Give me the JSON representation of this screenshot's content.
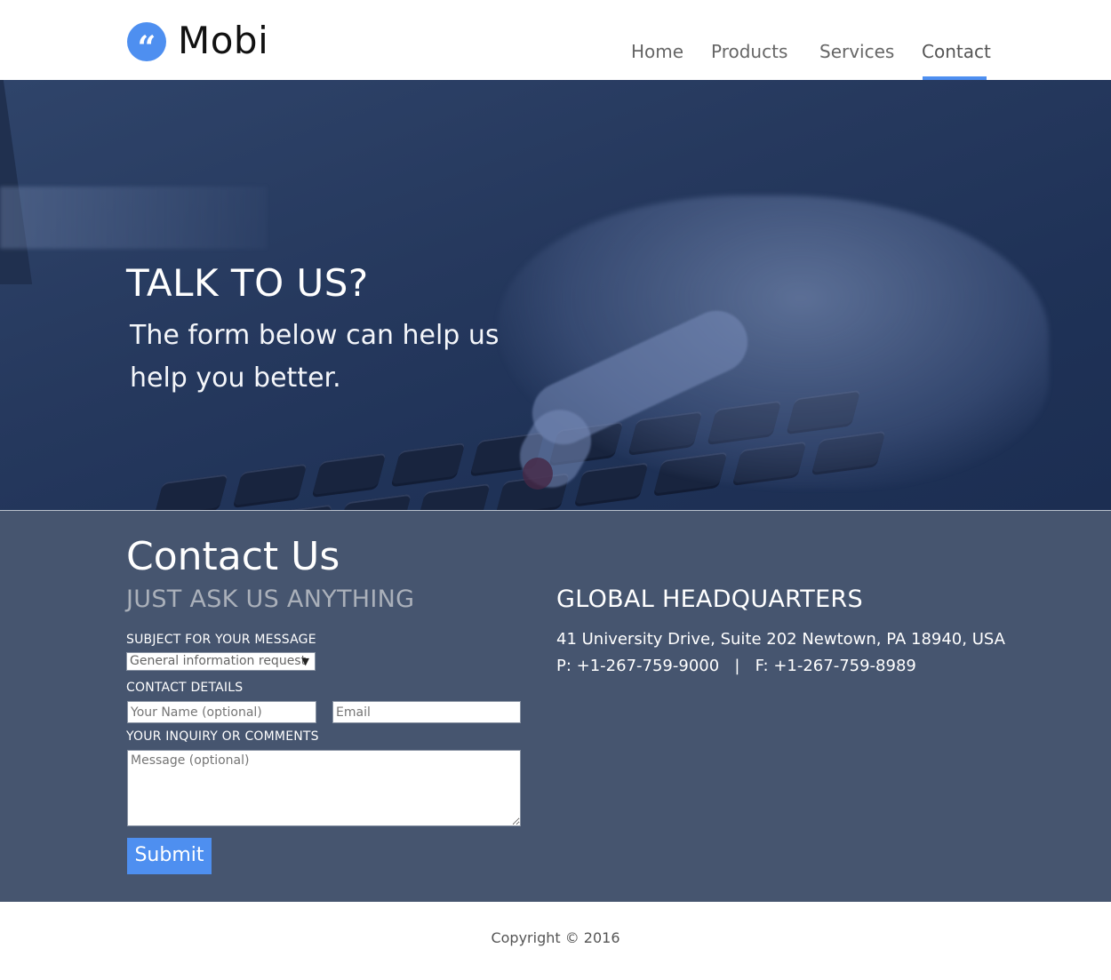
{
  "header": {
    "logo_icon": "quote-icon",
    "logo_glyph": "“",
    "logo_text": "Mobi",
    "nav": [
      {
        "label": "Home"
      },
      {
        "label": "Products"
      },
      {
        "label": "Services"
      },
      {
        "label": "Contact",
        "active": true
      }
    ]
  },
  "hero": {
    "title": "TALK TO US?",
    "subtitle": "The form below can help us help you better."
  },
  "contact": {
    "title": "Contact Us",
    "tagline": "JUST ASK US ANYTHING",
    "subject_label": "SUBJECT FOR YOUR MESSAGE",
    "subject_selected": "General information request",
    "details_label": "CONTACT DETAILS",
    "name_placeholder": "Your Name (optional)",
    "email_placeholder": "Email",
    "comments_label": "YOUR INQUIRY OR COMMENTS",
    "message_placeholder": "Message (optional)",
    "submit_label": "Submit"
  },
  "hq": {
    "title": "GLOBAL HEADQUARTERS",
    "address": "41 University Drive, Suite 202 Newtown, PA 18940, USA",
    "phones": "P: +1-267-759-9000   |   F: +1-267-759-8989"
  },
  "footer": {
    "copyright": "Copyright © 2016"
  },
  "colors": {
    "accent": "#4e8ff0",
    "contact_bg": "#46556f",
    "hero_overlay": "#1f3257"
  }
}
